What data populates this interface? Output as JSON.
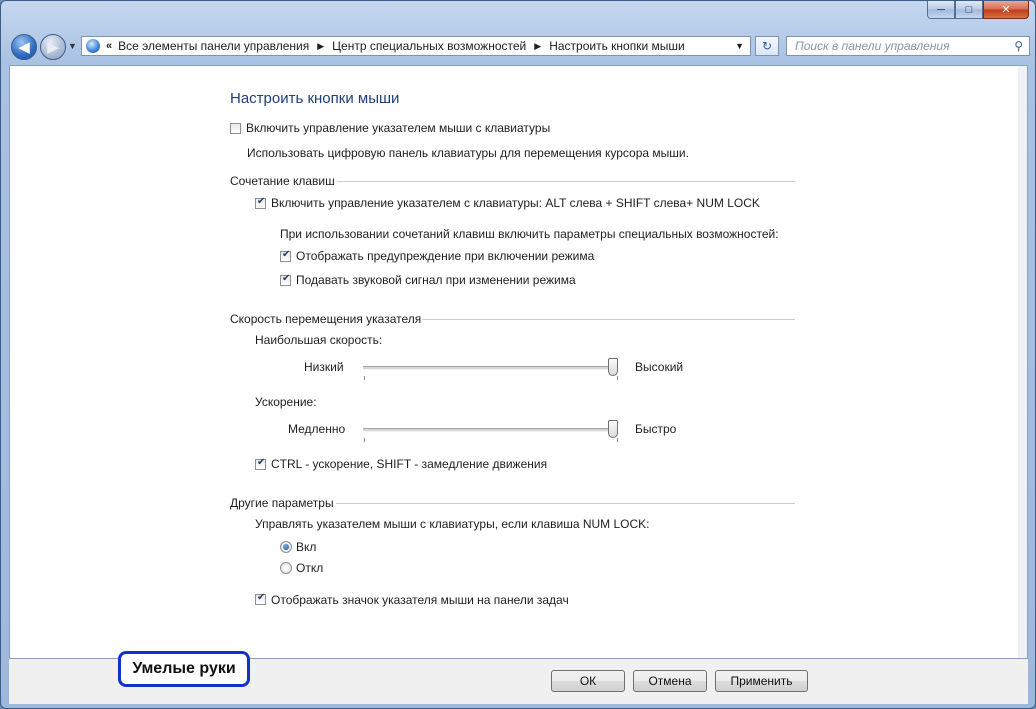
{
  "window": {
    "caption": {
      "minimize": "─",
      "maximize": "□",
      "close": "✕"
    }
  },
  "nav": {
    "back_glyph": "◀",
    "forward_glyph": "▶",
    "breadcrumb_prefix": "«",
    "breadcrumbs": [
      "Все элементы панели управления",
      "Центр специальных возможностей",
      "Настроить кнопки мыши"
    ],
    "breadcrumb_separator": "▶",
    "dropdown_glyph": "▼",
    "refresh_glyph": "↻",
    "search_placeholder": "Поиск в панели управления",
    "search_glyph": "⚲"
  },
  "page": {
    "title": "Настроить кнопки мыши",
    "enable_mousekeys": {
      "label": "Включить управление указателем мыши с клавиатуры",
      "checked": false
    },
    "enable_description": "Использовать цифровую панель клавиатуры для перемещения курсора мыши.",
    "shortcut_group": {
      "heading": "Сочетание клавиш",
      "enable_shortcut": {
        "label": "Включить управление указателем с клавиатуры: ALT слева + SHIFT слева+ NUM LOCK",
        "checked": true
      },
      "subheading": "При использовании сочетаний клавиш включить параметры специальных возможностей:",
      "show_warning": {
        "label": "Отображать предупреждение при включении режима",
        "checked": true
      },
      "play_sound": {
        "label": "Подавать звуковой сигнал при изменении режима",
        "checked": true
      }
    },
    "speed_group": {
      "heading": "Скорость перемещения указателя",
      "top_speed": {
        "label": "Наибольшая скорость:",
        "min_label": "Низкий",
        "max_label": "Высокий",
        "value": 0.98
      },
      "acceleration": {
        "label": "Ускорение:",
        "min_label": "Медленно",
        "max_label": "Быстро",
        "value": 0.98
      },
      "ctrl_shift": {
        "label": "CTRL - ускорение, SHIFT - замедление движения",
        "checked": true
      }
    },
    "other_group": {
      "heading": "Другие параметры",
      "numlock_label": "Управлять указателем мыши с клавиатуры, если клавиша NUM LOCK:",
      "radio_on": {
        "label": "Вкл",
        "selected": true
      },
      "radio_off": {
        "label": "Откл",
        "selected": false
      },
      "show_tray_icon": {
        "label": "Отображать значок указателя мыши на панели задач",
        "checked": true
      }
    }
  },
  "buttons": {
    "ok": "ОК",
    "cancel": "Отмена",
    "apply": "Применить"
  },
  "watermark": "Умелые руки"
}
